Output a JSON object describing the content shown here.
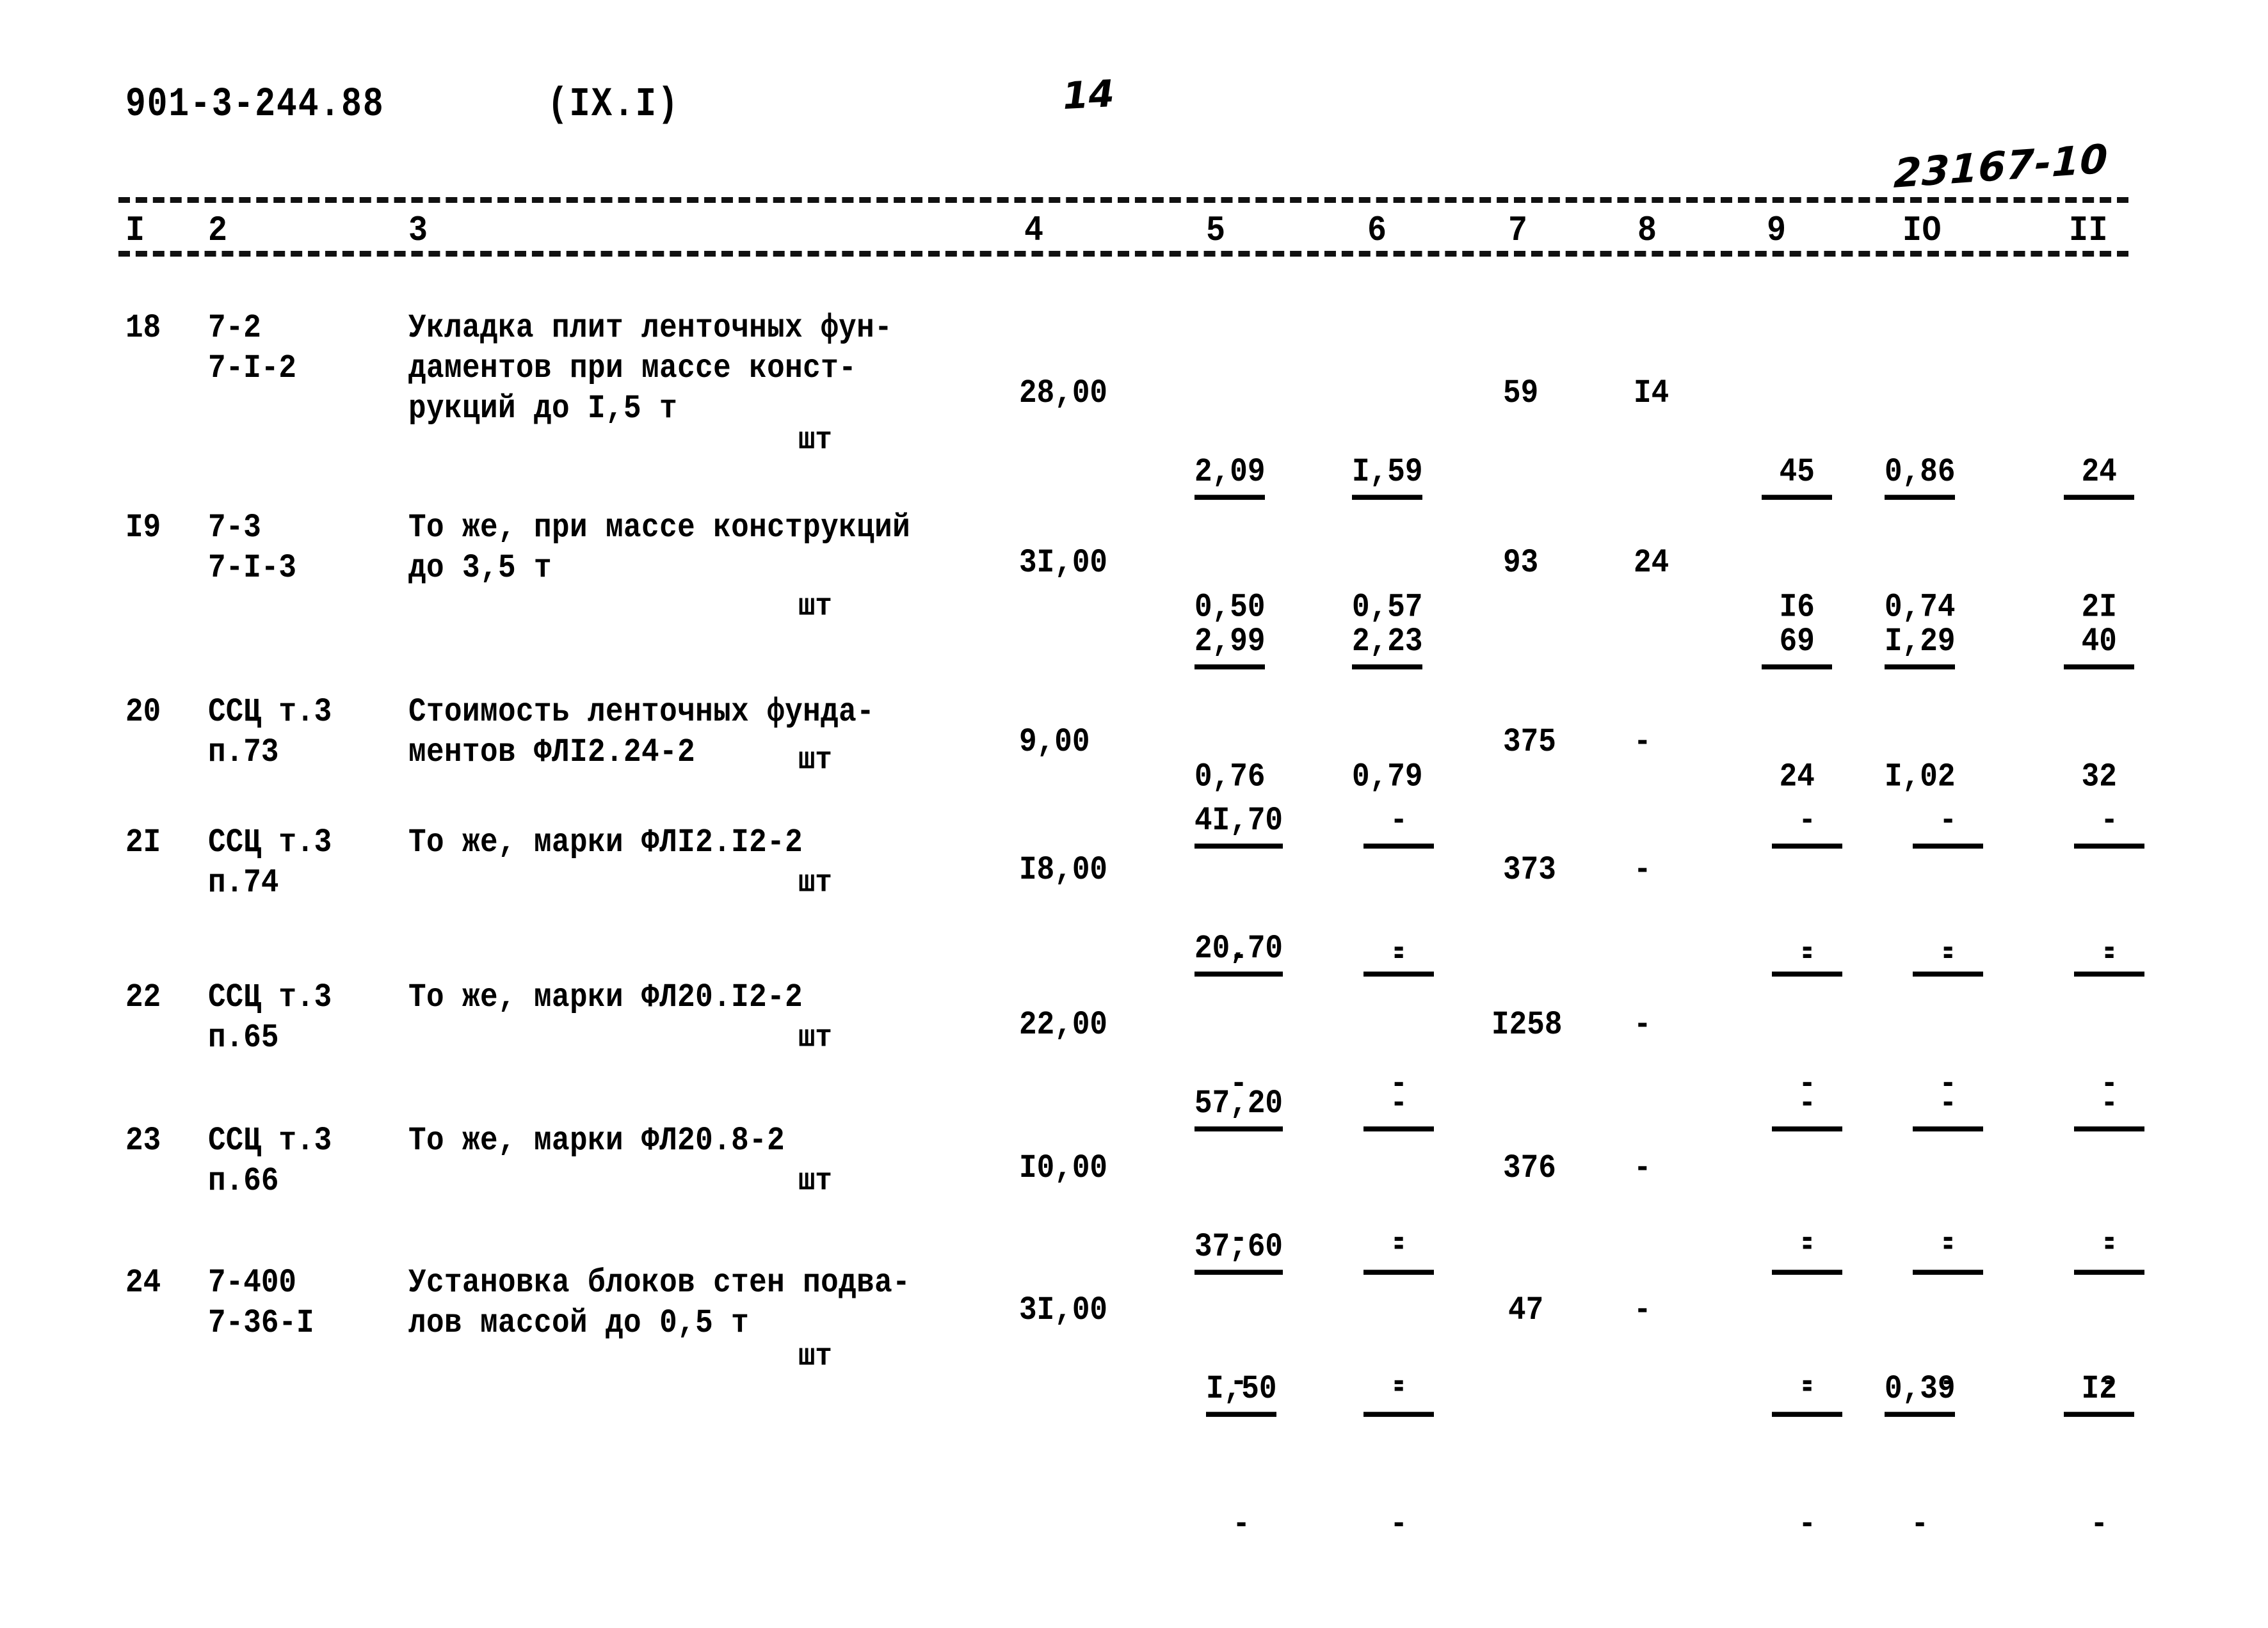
{
  "header": {
    "document_code": "901-3-244.88",
    "section": "(IX.I)",
    "page_number": "14",
    "stamp_number": "23167-10"
  },
  "table": {
    "column_headers": [
      "I",
      "2",
      "3",
      "4",
      "5",
      "6",
      "7",
      "8",
      "9",
      "IO",
      "II"
    ],
    "rows": [
      {
        "num": "18",
        "code_line1": "7-2",
        "code_line2": "7-I-2",
        "desc_line1": "Укладка плит ленточных фун-",
        "desc_line2": "даментов при массе конст-",
        "desc_line3": "рукций до I,5 т",
        "unit": "шт",
        "c4": "28,00",
        "c5_top": "2,09",
        "c5_bot": "0,50",
        "c6_top": "I,59",
        "c6_bot": "0,57",
        "c7": "59",
        "c8": "I4",
        "c9_top": "45",
        "c9_bot": "I6",
        "c10_top": "0,86",
        "c10_bot": "0,74",
        "c11_top": "24",
        "c11_bot": "2I"
      },
      {
        "num": "I9",
        "code_line1": "7-3",
        "code_line2": "7-I-3",
        "desc_line1": "То же, при массе конструкций",
        "desc_line2": "до 3,5 т",
        "desc_line3": "",
        "unit": "шт",
        "c4": "3I,00",
        "c5_top": "2,99",
        "c5_bot": "0,76",
        "c6_top": "2,23",
        "c6_bot": "0,79",
        "c7": "93",
        "c8": "24",
        "c9_top": "69",
        "c9_bot": "24",
        "c10_top": "I,29",
        "c10_bot": "I,02",
        "c11_top": "40",
        "c11_bot": "32"
      },
      {
        "num": "20",
        "code_line1": "ССЦ т.3",
        "code_line2": "п.73",
        "desc_line1": "Стоимость ленточных фунда-",
        "desc_line2": "ментов ФЛI2.24-2",
        "desc_line3": "",
        "unit": "шт",
        "c4": "9,00",
        "c5_top": "4I,70",
        "c5_bot": "-",
        "c6_top": "-",
        "c6_bot": "-",
        "c7": "375",
        "c8": "-",
        "c9_top": "-",
        "c9_bot": "-",
        "c10_top": "-",
        "c10_bot": "-",
        "c11_top": "-",
        "c11_bot": "-"
      },
      {
        "num": "2I",
        "code_line1": "ССЦ т.3",
        "code_line2": "п.74",
        "desc_line1": "То же, марки ФЛI2.I2-2",
        "desc_line2": "",
        "desc_line3": "",
        "unit": "шт",
        "c4": "I8,00",
        "c5_top": "20,70",
        "c5_bot": "-",
        "c6_top": "-",
        "c6_bot": "-",
        "c7": "373",
        "c8": "-",
        "c9_top": "-",
        "c9_bot": "-",
        "c10_top": "-",
        "c10_bot": "-",
        "c11_top": "-",
        "c11_bot": "-"
      },
      {
        "num": "22",
        "code_line1": "ССЦ т.3",
        "code_line2": "п.65",
        "desc_line1": "Тo же, марки ФЛ20.I2-2",
        "desc_line2": "",
        "desc_line3": "",
        "unit": "шт",
        "c4": "22,00",
        "c5_top": "57,20",
        "c5_bot": "-",
        "c6_top": "-",
        "c6_bot": "-",
        "c7": "I258",
        "c8": "-",
        "c9_top": "-",
        "c9_bot": "-",
        "c10_top": "-",
        "c10_bot": "-",
        "c11_top": "-",
        "c11_bot": "-"
      },
      {
        "num": "23",
        "code_line1": "ССЦ т.3",
        "code_line2": "п.66",
        "desc_line1": "То же, марки ФЛ20.8-2",
        "desc_line2": "",
        "desc_line3": "",
        "unit": "шт",
        "c4": "I0,00",
        "c5_top": "37,60",
        "c5_bot": "-",
        "c6_top": "-",
        "c6_bot": "-",
        "c7": "376",
        "c8": "-",
        "c9_top": "-",
        "c9_bot": "-",
        "c10_top": "-",
        "c10_bot": "-",
        "c11_top": "-",
        "c11_bot": "-"
      },
      {
        "num": "24",
        "code_line1": "7-400",
        "code_line2": "7-36-I",
        "desc_line1": "Установка блоков стен подва-",
        "desc_line2": "лов массой до 0,5 т",
        "desc_line3": "",
        "unit": "шт",
        "c4": "3I,00",
        "c5_top": "I,50",
        "c5_bot": "-",
        "c6_top": "-",
        "c6_bot": "-",
        "c7": "47",
        "c8": "-",
        "c9_top": "-",
        "c9_bot": "-",
        "c10_top": "0,39",
        "c10_bot": "-",
        "c11_top": "I2",
        "c11_bot": "-"
      }
    ]
  }
}
